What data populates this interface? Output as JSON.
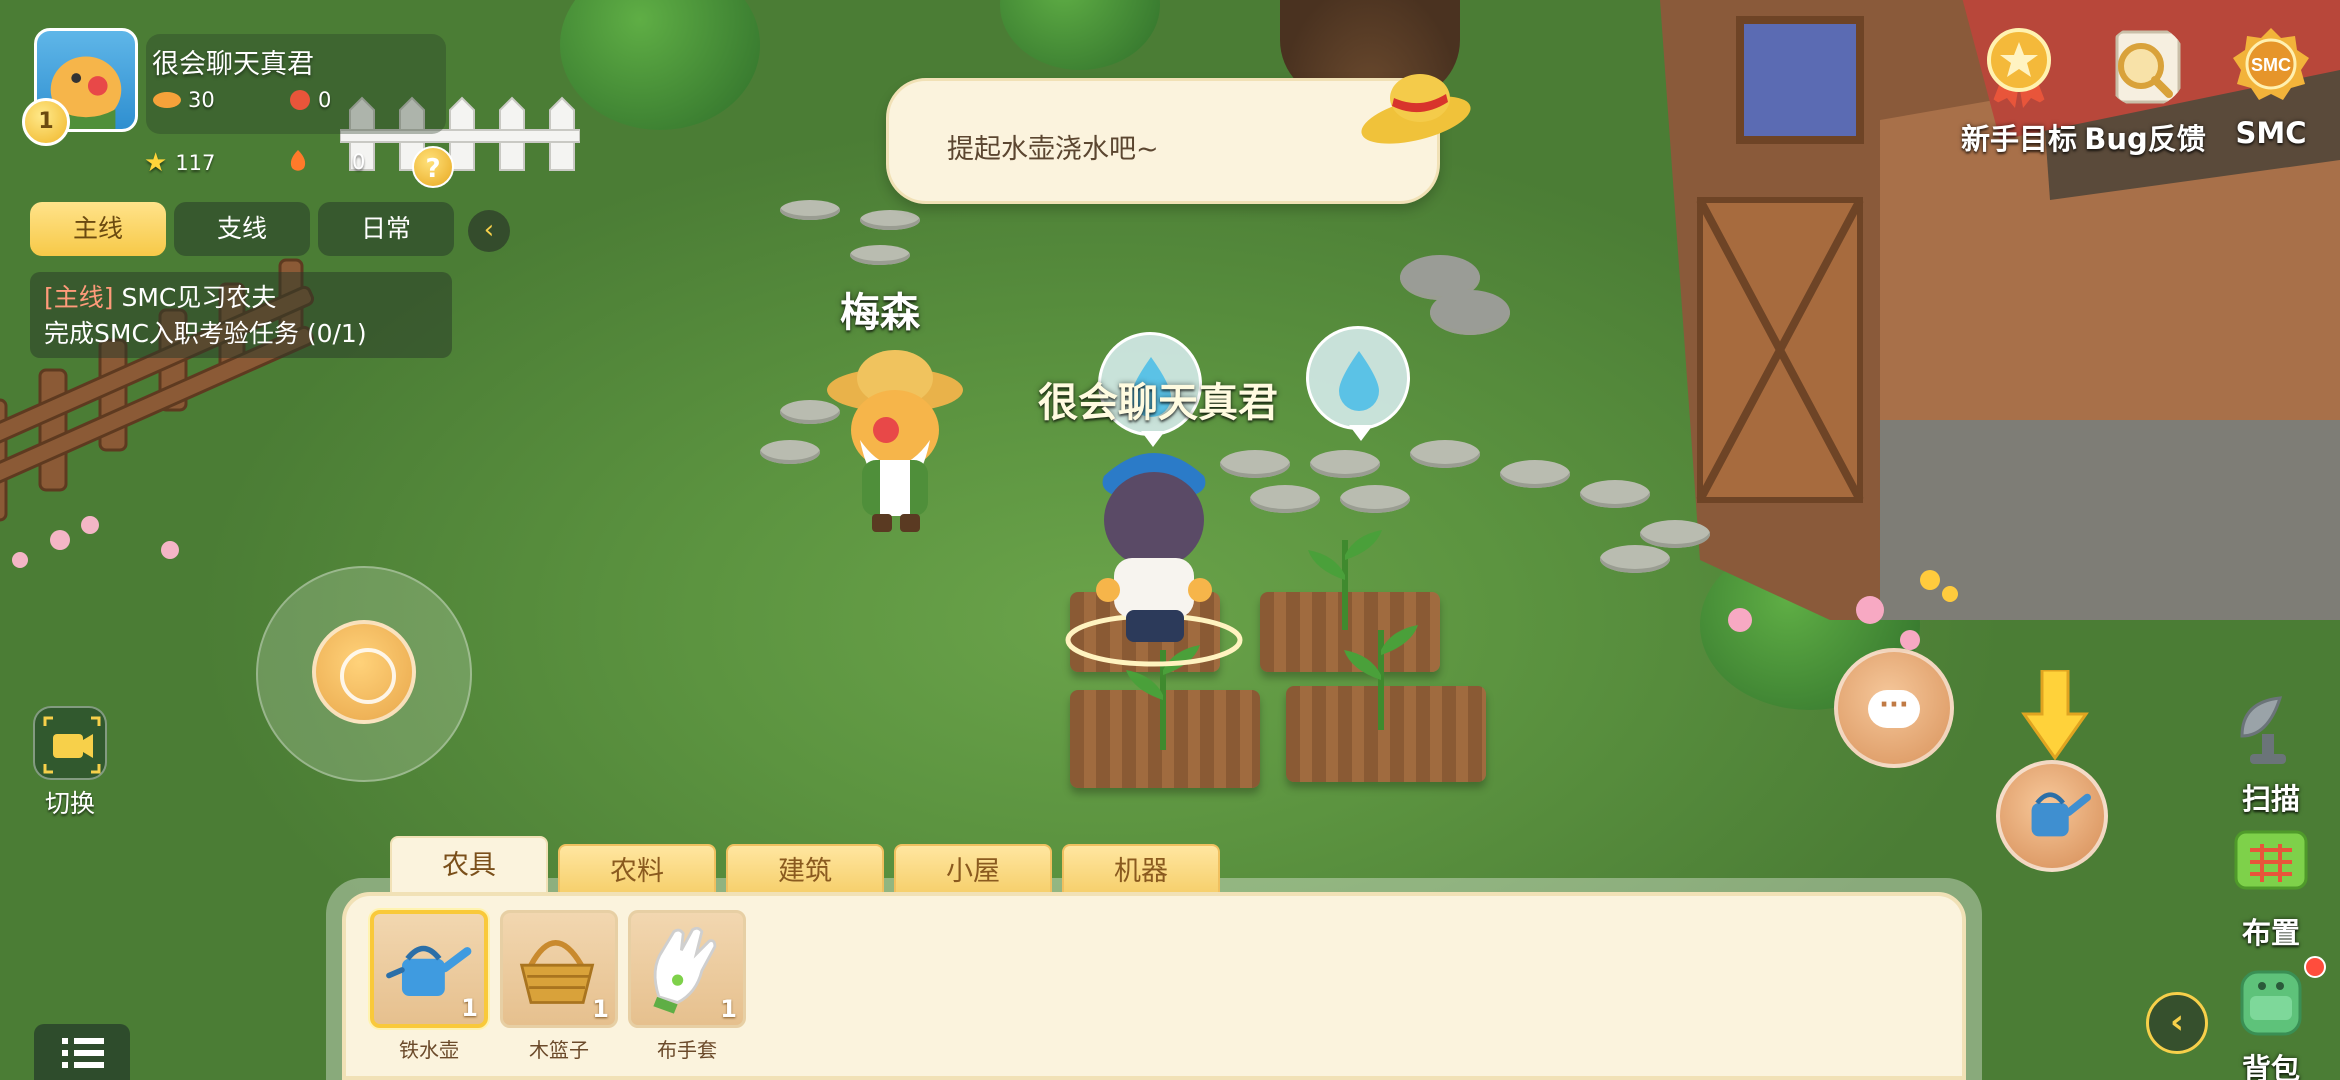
{
  "player": {
    "name": "很会聊天真君",
    "level": "1",
    "coins": "30",
    "gems": "0",
    "stars": "117",
    "energy": "0"
  },
  "quest": {
    "tabs": [
      "主线",
      "支线",
      "日常"
    ],
    "active_tab": "主线",
    "tag": "[主线]",
    "title": "SMC见习农夫",
    "task": "完成SMC入职考验任务 (0/1)"
  },
  "dialog": {
    "text": "提起水壶浇水吧~"
  },
  "npc": {
    "name": "梅森"
  },
  "top_right": {
    "newbie_goal": "新手目标",
    "bug_feedback": "Bug反馈",
    "smc": "SMC",
    "smc_badge": "SMC"
  },
  "controls": {
    "switch_label": "切换",
    "scan_label": "扫描",
    "layout_label": "布置",
    "bag_label": "背包",
    "help_symbol": "?",
    "chat_symbol": "···"
  },
  "inventory": {
    "tabs": [
      "农具",
      "农料",
      "建筑",
      "小屋",
      "机器"
    ],
    "active_tab": "农具",
    "items": [
      {
        "name": "铁水壶",
        "count": "1",
        "icon": "watering-can-icon"
      },
      {
        "name": "木篮子",
        "count": "1",
        "icon": "basket-icon"
      },
      {
        "name": "布手套",
        "count": "1",
        "icon": "glove-icon"
      }
    ]
  },
  "colors": {
    "accent_yellow": "#f7c948",
    "panel_cream": "#fbf3dd",
    "grass": "#5c9440",
    "quest_tag": "#ff9b7a"
  }
}
